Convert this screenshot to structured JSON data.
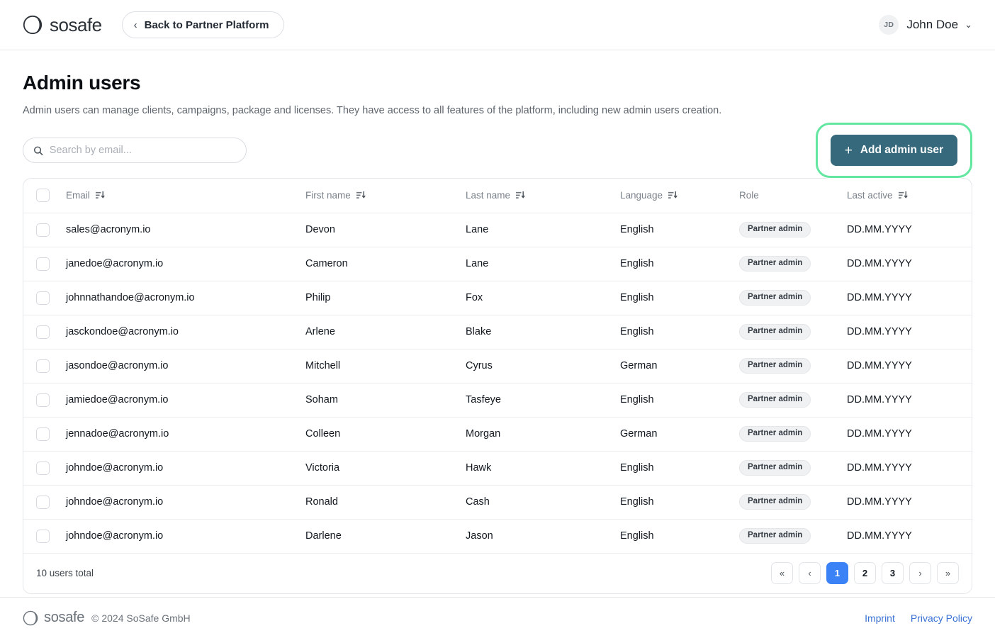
{
  "header": {
    "brand": "sosafe",
    "brand_logo_icon": "sosafe-circle-logo",
    "back_button": {
      "label": "Back to Partner Platform",
      "icon": "chevron-left-icon"
    },
    "user": {
      "initials": "JD",
      "name": "John Doe",
      "caret_icon": "chevron-down-icon"
    }
  },
  "page": {
    "title": "Admin users",
    "description": "Admin users can manage clients, campaigns, package and licenses. They have access to all features of the platform, including new admin users creation."
  },
  "toolbar": {
    "search": {
      "placeholder": "Search by email...",
      "value": "",
      "icon": "search-icon"
    },
    "add_button": {
      "label": "Add admin user",
      "icon": "plus-icon",
      "bg_color": "#36697c",
      "highlight_ring_color": "#63e6a0"
    }
  },
  "table": {
    "select_all_checkbox": "",
    "columns": [
      {
        "key": "email",
        "label": "Email",
        "sortable": true,
        "sort_icon": "sort-descending-icon"
      },
      {
        "key": "first_name",
        "label": "First name",
        "sortable": true,
        "sort_icon": "sort-descending-icon"
      },
      {
        "key": "last_name",
        "label": "Last name",
        "sortable": true,
        "sort_icon": "sort-descending-icon"
      },
      {
        "key": "language",
        "label": "Language",
        "sortable": true,
        "sort_icon": "sort-descending-icon"
      },
      {
        "key": "role",
        "label": "Role",
        "sortable": false
      },
      {
        "key": "last_active",
        "label": "Last active",
        "sortable": true,
        "sort_icon": "sort-descending-icon"
      }
    ],
    "row_action_icon": "pencil-edit-icon",
    "rows": [
      {
        "email": "sales@acronym.io",
        "first_name": "Devon",
        "last_name": "Lane",
        "language": "English",
        "role": "Partner admin",
        "last_active": "DD.MM.YYYY"
      },
      {
        "email": "janedoe@acronym.io",
        "first_name": "Cameron",
        "last_name": "Lane",
        "language": "English",
        "role": "Partner admin",
        "last_active": "DD.MM.YYYY"
      },
      {
        "email": "johnnathandoe@acronym.io",
        "first_name": "Philip",
        "last_name": "Fox",
        "language": "English",
        "role": "Partner admin",
        "last_active": "DD.MM.YYYY"
      },
      {
        "email": "jasckondoe@acronym.io",
        "first_name": "Arlene",
        "last_name": "Blake",
        "language": "English",
        "role": "Partner admin",
        "last_active": "DD.MM.YYYY"
      },
      {
        "email": "jasondoe@acronym.io",
        "first_name": "Mitchell",
        "last_name": "Cyrus",
        "language": "German",
        "role": "Partner admin",
        "last_active": "DD.MM.YYYY"
      },
      {
        "email": "jamiedoe@acronym.io",
        "first_name": "Soham",
        "last_name": "Tasfeye",
        "language": "English",
        "role": "Partner admin",
        "last_active": "DD.MM.YYYY"
      },
      {
        "email": "jennadoe@acronym.io",
        "first_name": "Colleen",
        "last_name": "Morgan",
        "language": "German",
        "role": "Partner admin",
        "last_active": "DD.MM.YYYY"
      },
      {
        "email": "johndoe@acronym.io",
        "first_name": "Victoria",
        "last_name": "Hawk",
        "language": "English",
        "role": "Partner admin",
        "last_active": "DD.MM.YYYY"
      },
      {
        "email": "johndoe@acronym.io",
        "first_name": "Ronald",
        "last_name": "Cash",
        "language": "English",
        "role": "Partner admin",
        "last_active": "DD.MM.YYYY"
      },
      {
        "email": "johndoe@acronym.io",
        "first_name": "Darlene",
        "last_name": "Jason",
        "language": "English",
        "role": "Partner admin",
        "last_active": "DD.MM.YYYY"
      }
    ]
  },
  "pagination": {
    "total_label": "10 users total",
    "first_label": "«",
    "prev_label": "‹",
    "next_label": "›",
    "last_label": "»",
    "pages": [
      "1",
      "2",
      "3"
    ],
    "active_page": "1",
    "active_color": "#3b82f6"
  },
  "footer": {
    "brand": "sosafe",
    "brand_logo_icon": "sosafe-circle-logo",
    "copyright": "© 2024 SoSafe GmbH",
    "links": [
      {
        "label": "Imprint"
      },
      {
        "label": "Privacy Policy"
      }
    ]
  }
}
